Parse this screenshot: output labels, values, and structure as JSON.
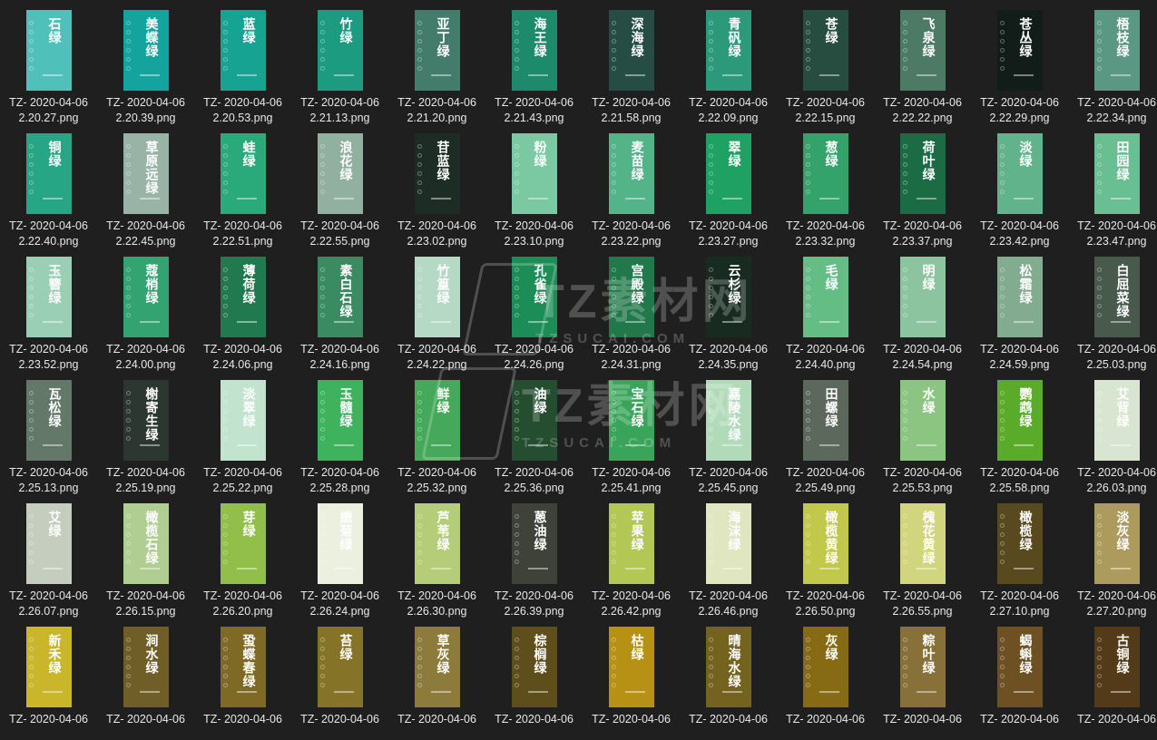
{
  "watermark": {
    "main": "TZ素材网",
    "sub": "TZSUCAI.COM"
  },
  "files": [
    {
      "name": "石绿",
      "line1": "TZ- 2020-04-06",
      "line2": "2.20.27.png",
      "color": "#4fc1ba"
    },
    {
      "name": "美蝶绿",
      "line1": "TZ- 2020-04-06",
      "line2": "2.20.39.png",
      "color": "#15a49d"
    },
    {
      "name": "蓝绿",
      "line1": "TZ- 2020-04-06",
      "line2": "2.20.53.png",
      "color": "#16a391"
    },
    {
      "name": "竹绿",
      "line1": "TZ- 2020-04-06",
      "line2": "2.21.13.png",
      "color": "#1c9b80"
    },
    {
      "name": "亚丁绿",
      "line1": "TZ- 2020-04-06",
      "line2": "2.21.20.png",
      "color": "#447c6c"
    },
    {
      "name": "海王绿",
      "line1": "TZ- 2020-04-06",
      "line2": "2.21.43.png",
      "color": "#1e8a6c"
    },
    {
      "name": "深海绿",
      "line1": "TZ- 2020-04-06",
      "line2": "2.21.58.png",
      "color": "#254d43"
    },
    {
      "name": "青矾绿",
      "line1": "TZ- 2020-04-06",
      "line2": "2.22.09.png",
      "color": "#2c9a7a"
    },
    {
      "name": "苍绿",
      "line1": "TZ- 2020-04-06",
      "line2": "2.22.15.png",
      "color": "#264d3f"
    },
    {
      "name": "飞泉绿",
      "line1": "TZ- 2020-04-06",
      "line2": "2.22.22.png",
      "color": "#4c7a64"
    },
    {
      "name": "苍丛绿",
      "line1": "TZ- 2020-04-06",
      "line2": "2.22.29.png",
      "color": "#121c18"
    },
    {
      "name": "梧枝绿",
      "line1": "TZ- 2020-04-06",
      "line2": "2.22.34.png",
      "color": "#5b9884"
    },
    {
      "name": "铜绿",
      "line1": "TZ- 2020-04-06",
      "line2": "2.22.40.png",
      "color": "#27a685"
    },
    {
      "name": "草原远绿",
      "line1": "TZ- 2020-04-06",
      "line2": "2.22.45.png",
      "color": "#99b3a6"
    },
    {
      "name": "蛙绿",
      "line1": "TZ- 2020-04-06",
      "line2": "2.22.51.png",
      "color": "#2aa97b"
    },
    {
      "name": "浪花绿",
      "line1": "TZ- 2020-04-06",
      "line2": "2.22.55.png",
      "color": "#92b0a0"
    },
    {
      "name": "苷蓝绿",
      "line1": "TZ- 2020-04-06",
      "line2": "2.23.02.png",
      "color": "#1d2d25"
    },
    {
      "name": "粉绿",
      "line1": "TZ- 2020-04-06",
      "line2": "2.23.10.png",
      "color": "#7bc9a2"
    },
    {
      "name": "麦苗绿",
      "line1": "TZ- 2020-04-06",
      "line2": "2.23.22.png",
      "color": "#53b48a"
    },
    {
      "name": "翠绿",
      "line1": "TZ- 2020-04-06",
      "line2": "2.23.27.png",
      "color": "#1fa163"
    },
    {
      "name": "葱绿",
      "line1": "TZ- 2020-04-06",
      "line2": "2.23.32.png",
      "color": "#34a36b"
    },
    {
      "name": "荷叶绿",
      "line1": "TZ- 2020-04-06",
      "line2": "2.23.37.png",
      "color": "#1b6b45"
    },
    {
      "name": "淡绿",
      "line1": "TZ- 2020-04-06",
      "line2": "2.23.42.png",
      "color": "#60b38a"
    },
    {
      "name": "田园绿",
      "line1": "TZ- 2020-04-06",
      "line2": "2.23.47.png",
      "color": "#69bf92"
    },
    {
      "name": "玉簪绿",
      "line1": "TZ- 2020-04-06",
      "line2": "2.23.52.png",
      "color": "#9bcfb5"
    },
    {
      "name": "蔻梢绿",
      "line1": "TZ- 2020-04-06",
      "line2": "2.24.00.png",
      "color": "#33a372"
    },
    {
      "name": "薄荷绿",
      "line1": "TZ- 2020-04-06",
      "line2": "2.24.06.png",
      "color": "#217a4f"
    },
    {
      "name": "素白石绿",
      "line1": "TZ- 2020-04-06",
      "line2": "2.24.16.png",
      "color": "#3a8a62"
    },
    {
      "name": "竹篁绿",
      "line1": "TZ- 2020-04-06",
      "line2": "2.24.22.png",
      "color": "#b6d9c5"
    },
    {
      "name": "孔雀绿",
      "line1": "TZ- 2020-04-06",
      "line2": "2.24.26.png",
      "color": "#1c8d56"
    },
    {
      "name": "宫殿绿",
      "line1": "TZ- 2020-04-06",
      "line2": "2.24.31.png",
      "color": "#20784b"
    },
    {
      "name": "云杉绿",
      "line1": "TZ- 2020-04-06",
      "line2": "2.24.35.png",
      "color": "#182b20"
    },
    {
      "name": "毛绿",
      "line1": "TZ- 2020-04-06",
      "line2": "2.24.40.png",
      "color": "#65bd86"
    },
    {
      "name": "明绿",
      "line1": "TZ- 2020-04-06",
      "line2": "2.24.54.png",
      "color": "#8cc49f"
    },
    {
      "name": "松霜绿",
      "line1": "TZ- 2020-04-06",
      "line2": "2.24.59.png",
      "color": "#82ab90"
    },
    {
      "name": "白屈菜绿",
      "line1": "TZ- 2020-04-06",
      "line2": "2.25.03.png",
      "color": "#475a4b"
    },
    {
      "name": "瓦松绿",
      "line1": "TZ- 2020-04-06",
      "line2": "2.25.13.png",
      "color": "#64786a"
    },
    {
      "name": "榭寄生绿",
      "line1": "TZ- 2020-04-06",
      "line2": "2.25.19.png",
      "color": "#2b3730"
    },
    {
      "name": "淡翠绿",
      "line1": "TZ- 2020-04-06",
      "line2": "2.25.22.png",
      "color": "#c2e3cd"
    },
    {
      "name": "玉髓绿",
      "line1": "TZ- 2020-04-06",
      "line2": "2.25.28.png",
      "color": "#3fb25e"
    },
    {
      "name": "鲜绿",
      "line1": "TZ- 2020-04-06",
      "line2": "2.25.32.png",
      "color": "#46a85a"
    },
    {
      "name": "油绿",
      "line1": "TZ- 2020-04-06",
      "line2": "2.25.36.png",
      "color": "#254d30"
    },
    {
      "name": "宝石绿",
      "line1": "TZ- 2020-04-06",
      "line2": "2.25.41.png",
      "color": "#39a55a"
    },
    {
      "name": "嘉陵水绿",
      "line1": "TZ- 2020-04-06",
      "line2": "2.25.45.png",
      "color": "#b1dab9"
    },
    {
      "name": "田螺绿",
      "line1": "TZ- 2020-04-06",
      "line2": "2.25.49.png",
      "color": "#5d685c"
    },
    {
      "name": "水绿",
      "line1": "TZ- 2020-04-06",
      "line2": "2.25.53.png",
      "color": "#8cc481"
    },
    {
      "name": "鹦鹉绿",
      "line1": "TZ- 2020-04-06",
      "line2": "2.25.58.png",
      "color": "#5aab2a"
    },
    {
      "name": "艾背绿",
      "line1": "TZ- 2020-04-06",
      "line2": "2.26.03.png",
      "color": "#d8e5d0"
    },
    {
      "name": "艾绿",
      "line1": "TZ- 2020-04-06",
      "line2": "2.26.07.png",
      "color": "#c5cdbe"
    },
    {
      "name": "橄榄石绿",
      "line1": "TZ- 2020-04-06",
      "line2": "2.26.15.png",
      "color": "#b1ce92"
    },
    {
      "name": "芽绿",
      "line1": "TZ- 2020-04-06",
      "line2": "2.26.20.png",
      "color": "#92be4a"
    },
    {
      "name": "嫩菊绿",
      "line1": "TZ- 2020-04-06",
      "line2": "2.26.24.png",
      "color": "#ecf0df"
    },
    {
      "name": "芦苇绿",
      "line1": "TZ- 2020-04-06",
      "line2": "2.26.30.png",
      "color": "#b5cc78"
    },
    {
      "name": "蒽油绿",
      "line1": "TZ- 2020-04-06",
      "line2": "2.26.39.png",
      "color": "#3f4238"
    },
    {
      "name": "苹果绿",
      "line1": "TZ- 2020-04-06",
      "line2": "2.26.42.png",
      "color": "#b3c755"
    },
    {
      "name": "海沫绿",
      "line1": "TZ- 2020-04-06",
      "line2": "2.26.46.png",
      "color": "#dfe6c0"
    },
    {
      "name": "橄榄黄绿",
      "line1": "TZ- 2020-04-06",
      "line2": "2.26.50.png",
      "color": "#c2c94a"
    },
    {
      "name": "槐花黄绿",
      "line1": "TZ- 2020-04-06",
      "line2": "2.26.55.png",
      "color": "#d1d57e"
    },
    {
      "name": "橄榄绿",
      "line1": "TZ- 2020-04-06",
      "line2": "2.27.10.png",
      "color": "#584a1e"
    },
    {
      "name": "淡灰绿",
      "line1": "TZ- 2020-04-06",
      "line2": "2.27.20.png",
      "color": "#ad9b5d"
    },
    {
      "name": "新禾绿",
      "line1": "TZ- 2020-04-06",
      "line2": "",
      "color": "#c9b62a"
    },
    {
      "name": "涧水绿",
      "line1": "TZ- 2020-04-06",
      "line2": "",
      "color": "#6f5e27"
    },
    {
      "name": "蛩蝶春绿",
      "line1": "TZ- 2020-04-06",
      "line2": "",
      "color": "#7e6a24"
    },
    {
      "name": "苔绿",
      "line1": "TZ- 2020-04-06",
      "line2": "",
      "color": "#857428"
    },
    {
      "name": "草灰绿",
      "line1": "TZ- 2020-04-06",
      "line2": "",
      "color": "#8d7b3c"
    },
    {
      "name": "棕榈绿",
      "line1": "TZ- 2020-04-06",
      "line2": "",
      "color": "#5d4e1b"
    },
    {
      "name": "枯绿",
      "line1": "TZ- 2020-04-06",
      "line2": "",
      "color": "#b69114"
    },
    {
      "name": "晴海水绿",
      "line1": "TZ- 2020-04-06",
      "line2": "",
      "color": "#74621f"
    },
    {
      "name": "灰绿",
      "line1": "TZ- 2020-04-06",
      "line2": "",
      "color": "#866b14"
    },
    {
      "name": "粽叶绿",
      "line1": "TZ- 2020-04-06",
      "line2": "",
      "color": "#887039"
    },
    {
      "name": "蝎蝌绿",
      "line1": "TZ- 2020-04-06",
      "line2": "",
      "color": "#6d5123"
    },
    {
      "name": "古铜绿",
      "line1": "TZ- 2020-04-06",
      "line2": "",
      "color": "#533b19"
    }
  ]
}
